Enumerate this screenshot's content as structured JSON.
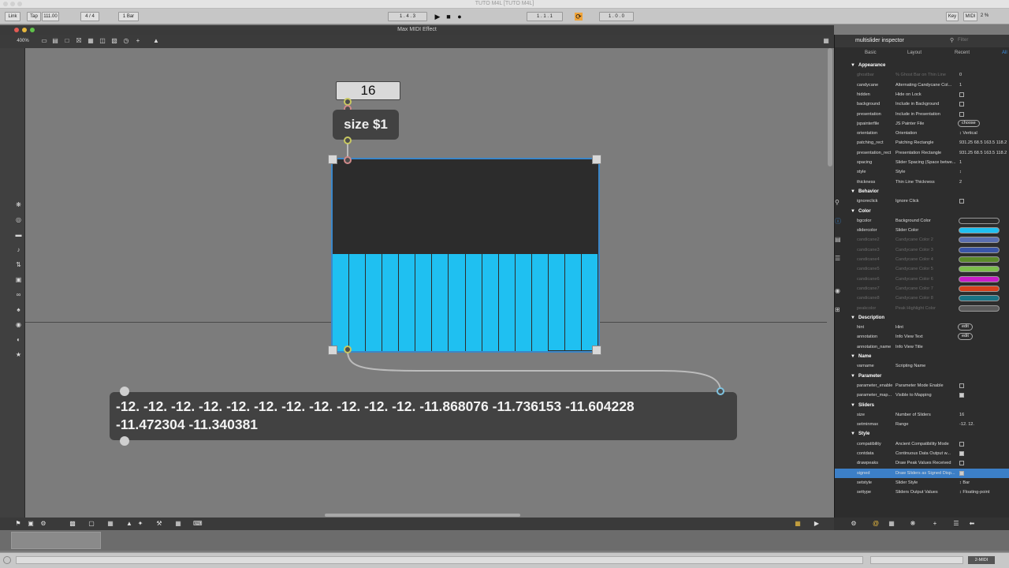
{
  "mac": {
    "title": "TUTO M4L  [TUTO M4L]"
  },
  "live": {
    "link": "Link",
    "tap": "Tap",
    "tempo": "111.00",
    "meter": "4 / 4",
    "quantize": "1 Bar",
    "arrangement_pos": "1 .  4 .  3",
    "loop_start": "1 .  1 .  1",
    "loop_len": "1 .  0 .  0",
    "key": "Key",
    "midi": "MIDI",
    "cpu": "2 %"
  },
  "max": {
    "window_title": "Max MIDI Effect",
    "zoom": "400%"
  },
  "patch": {
    "number_value": "16",
    "message_text": "size $1",
    "output_line1": "-12. -12. -12. -12. -12. -12. -12. -12. -12. -12. -12. -11.868076 -11.736153 -11.604228",
    "output_line2": "-11.472304 -11.340381",
    "slider_values": [
      -12,
      -12,
      -12,
      -12,
      -12,
      -12,
      -12,
      -12,
      -12,
      -12,
      -12,
      -11.868076,
      -11.736153,
      -11.604228,
      -11.472304,
      -11.340381
    ],
    "slider_range": [
      -12,
      12
    ],
    "slider_color": "#1fc0f1",
    "bg_color": "#2c2c2c"
  },
  "inspector": {
    "title": "multislider inspector",
    "filter_placeholder": "Filter",
    "tabs": [
      "Basic",
      "Layout",
      "Recent",
      "All"
    ],
    "rows": [
      {
        "type": "sec",
        "label": "Appearance"
      },
      {
        "type": "row",
        "k": "ghostbar",
        "d": "% Ghost Bar on Thin Line",
        "v": "0",
        "dim": true
      },
      {
        "type": "row",
        "k": "candycane",
        "d": "Alternating Candycane Col...",
        "v": "1"
      },
      {
        "type": "row",
        "k": "hidden",
        "d": "Hide on Lock",
        "chk": false
      },
      {
        "type": "row",
        "k": "background",
        "d": "Include in Background",
        "chk": false
      },
      {
        "type": "row",
        "k": "presentation",
        "d": "Include in Presentation",
        "chk": false
      },
      {
        "type": "row",
        "k": "jspainterfile",
        "d": "JS Painter File",
        "pill": "choose"
      },
      {
        "type": "row",
        "k": "orientation",
        "d": "Orientation",
        "v": "↕ Vertical"
      },
      {
        "type": "row",
        "k": "patching_rect",
        "d": "Patching Rectangle",
        "v": "931.25 68.5 163.5 118.2"
      },
      {
        "type": "row",
        "k": "presentation_rect",
        "d": "Presentation Rectangle",
        "v": "931.25 68.5 163.5 118.2"
      },
      {
        "type": "row",
        "k": "spacing",
        "d": "Slider Spacing (Space betwe...",
        "v": "1"
      },
      {
        "type": "row",
        "k": "style",
        "d": "Style",
        "v": "↕"
      },
      {
        "type": "row",
        "k": "thickness",
        "d": "Thin Line Thickness",
        "v": "2"
      },
      {
        "type": "sec",
        "label": "Behavior"
      },
      {
        "type": "row",
        "k": "ignoreclick",
        "d": "Ignore Click",
        "chk": false
      },
      {
        "type": "sec",
        "label": "Color"
      },
      {
        "type": "row",
        "k": "bgcolor",
        "d": "Background Color",
        "swatch": "#2c2c2c"
      },
      {
        "type": "row",
        "k": "slidercolor",
        "d": "Slider Color",
        "swatch": "#1fc0f1"
      },
      {
        "type": "row",
        "k": "candicane2",
        "d": "Candycane Color 2",
        "swatch": "#5b6fb0",
        "dim": true
      },
      {
        "type": "row",
        "k": "candicane3",
        "d": "Candycane Color 3",
        "swatch": "#3a55a8",
        "dim": true
      },
      {
        "type": "row",
        "k": "candicane4",
        "d": "Candycane Color 4",
        "swatch": "#5b8a2a",
        "dim": true
      },
      {
        "type": "row",
        "k": "candicane5",
        "d": "Candycane Color 5",
        "swatch": "#7cbe4c",
        "dim": true
      },
      {
        "type": "row",
        "k": "candicane6",
        "d": "Candycane Color 6",
        "swatch": "#c81ec8",
        "dim": true
      },
      {
        "type": "row",
        "k": "candicane7",
        "d": "Candycane Color 7",
        "swatch": "#d8411c",
        "dim": true
      },
      {
        "type": "row",
        "k": "candicane8",
        "d": "Candycane Color 8",
        "swatch": "#1a7384",
        "dim": true
      },
      {
        "type": "row",
        "k": "peakcolor",
        "d": "Peak Highlight Color",
        "swatch": "#5a5a5a",
        "dim": true
      },
      {
        "type": "sec",
        "label": "Description"
      },
      {
        "type": "row",
        "k": "hint",
        "d": "Hint",
        "pill": "edit"
      },
      {
        "type": "row",
        "k": "annotation",
        "d": "Info View Text",
        "pill": "edit"
      },
      {
        "type": "row",
        "k": "annotation_name",
        "d": "Info View Title"
      },
      {
        "type": "sec",
        "label": "Name"
      },
      {
        "type": "row",
        "k": "varname",
        "d": "Scripting Name"
      },
      {
        "type": "sec",
        "label": "Parameter"
      },
      {
        "type": "row",
        "k": "parameter_enable",
        "d": "Parameter Mode Enable",
        "chk": false
      },
      {
        "type": "row",
        "k": "parameter_map...",
        "d": "Visible to Mapping",
        "chk": true
      },
      {
        "type": "sec",
        "label": "Sliders"
      },
      {
        "type": "row",
        "k": "size",
        "d": "Number of Sliders",
        "v": "16"
      },
      {
        "type": "row",
        "k": "setminmax",
        "d": "Range",
        "v": "-12. 12."
      },
      {
        "type": "sec",
        "label": "Style"
      },
      {
        "type": "row",
        "k": "compatibility",
        "d": "Ancient Compatibility Mode",
        "chk": false
      },
      {
        "type": "row",
        "k": "contdata",
        "d": "Continuous Data Output w...",
        "chk": true
      },
      {
        "type": "row",
        "k": "drawpeaks",
        "d": "Draw Peak Values Received",
        "chk": false
      },
      {
        "type": "row",
        "k": "signed",
        "d": "Draw Sliders as Signed Disp...",
        "chk": true,
        "sel": true
      },
      {
        "type": "row",
        "k": "setstyle",
        "d": "Slider Style",
        "v": "↕ Bar"
      },
      {
        "type": "row",
        "k": "settype",
        "d": "Sliders Output Values",
        "v": "↕ Floating-point"
      }
    ]
  },
  "status": {
    "midi_label": "2-MIDI"
  }
}
